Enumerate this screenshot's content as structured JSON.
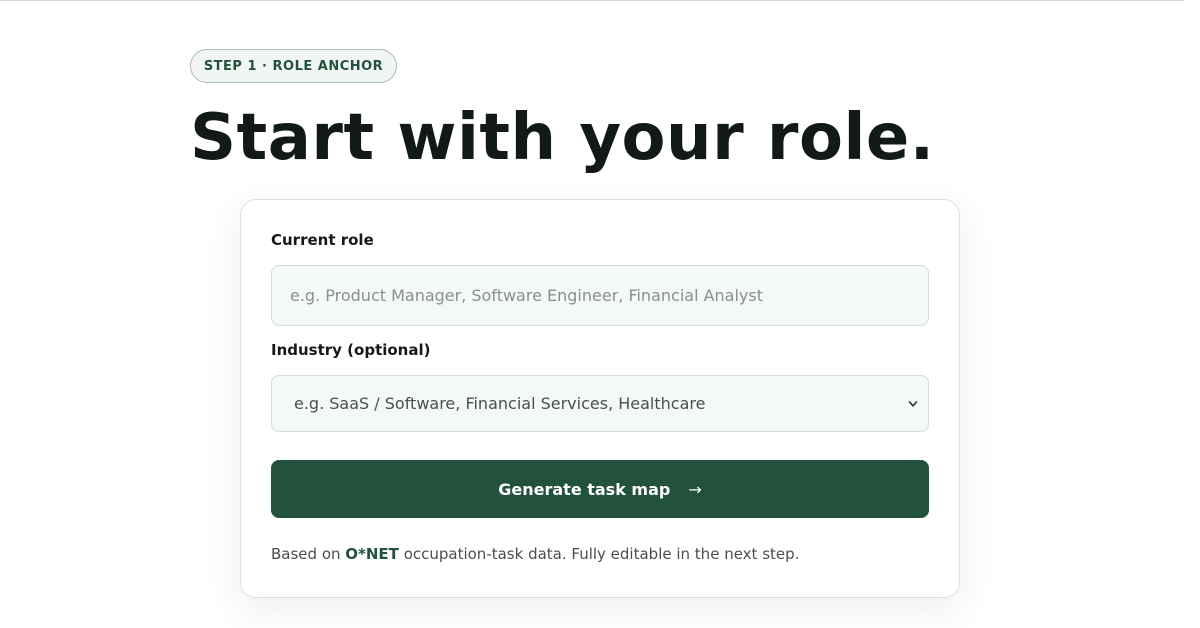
{
  "step_badge": "STEP 1 · ROLE ANCHOR",
  "title": "Start with your role.",
  "form": {
    "role_label": "Current role",
    "role_placeholder": "e.g. Product Manager, Software Engineer, Financial Analyst",
    "industry_label": "Industry (optional)",
    "industry_selected": "e.g. SaaS / Software, Financial Services, Healthcare",
    "submit_label": "Generate task map",
    "submit_icon": "arrow-right-icon"
  },
  "footnote": {
    "prefix": "Based on ",
    "source": "O*NET",
    "suffix": " occupation-task data. Fully editable in the next step."
  },
  "colors": {
    "accent": "#22523e",
    "badge_bg": "#f1f6f3",
    "input_bg": "#f5f9f6",
    "title": "#111a15"
  }
}
